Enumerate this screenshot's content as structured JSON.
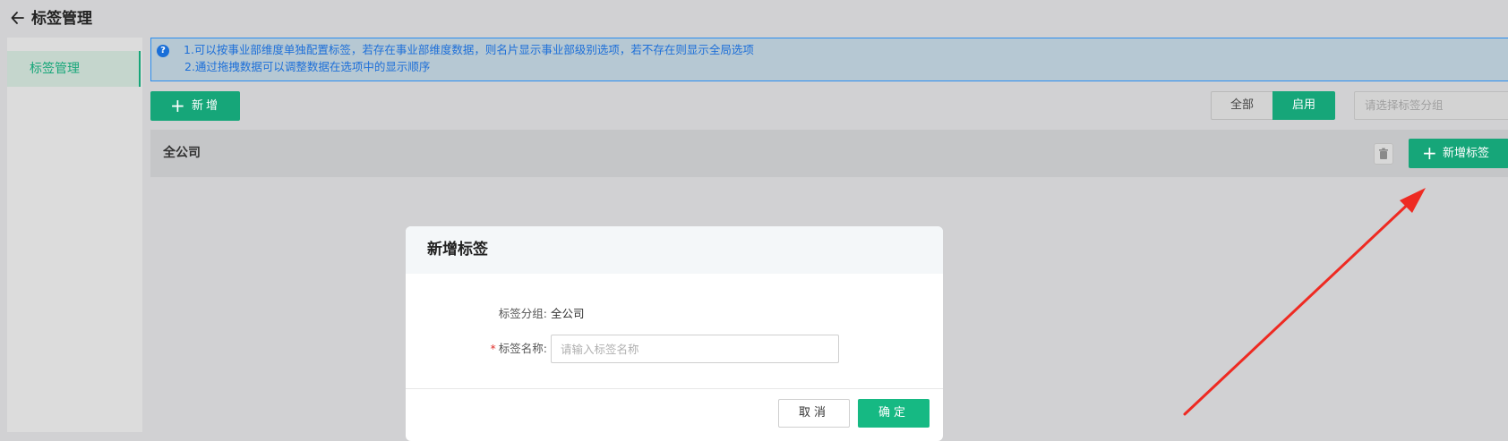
{
  "header": {
    "title": "标签管理"
  },
  "sidebar": {
    "items": [
      {
        "label": "标签管理",
        "active": true
      }
    ]
  },
  "notice": {
    "lines": [
      "1.可以按事业部维度单独配置标签，若存在事业部维度数据，则名片显示事业部级别选项，若不存在则显示全局选项",
      "2.通过拖拽数据可以调整数据在选项中的显示顺序"
    ],
    "icon": "question-circle-icon"
  },
  "toolbar": {
    "add_label": "新增",
    "filter": {
      "all_label": "全部",
      "enabled_label": "启用",
      "selected": "启用"
    },
    "group_select_placeholder": "请选择标签分组"
  },
  "group": {
    "name": "全公司",
    "add_tag_label": "新增标签"
  },
  "dialog": {
    "title": "新增标签",
    "group_label": "标签分组:",
    "group_value": "全公司",
    "name_label": "标签名称:",
    "required_mark": "*",
    "name_placeholder": "请输入标签名称",
    "cancel_label": "取消",
    "confirm_label": "确定"
  },
  "colors": {
    "primary": "#16a679",
    "confirm": "#16b983",
    "notice_text": "#1d6fd8",
    "annotation_arrow": "#ee2a22"
  }
}
